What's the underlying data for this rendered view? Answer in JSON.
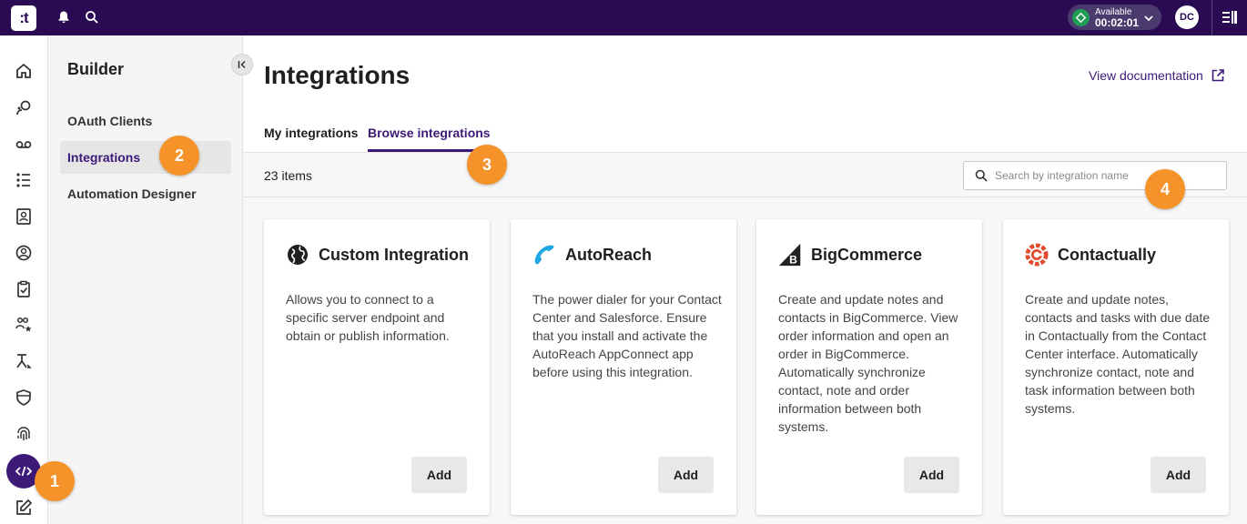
{
  "topbar": {
    "logo_text": ":t",
    "status_label": "Available",
    "status_timer": "00:02:01",
    "avatar_initials": "DC"
  },
  "sidebar": {
    "title": "Builder",
    "items": [
      {
        "label": "OAuth Clients"
      },
      {
        "label": "Integrations"
      },
      {
        "label": "Automation Designer"
      }
    ]
  },
  "main": {
    "title": "Integrations",
    "doc_link": "View documentation",
    "tabs": [
      {
        "label": "My integrations"
      },
      {
        "label": "Browse integrations"
      }
    ],
    "item_count": "23 items",
    "search_placeholder": "Search by integration name"
  },
  "cards": [
    {
      "title": "Custom Integration",
      "description": "Allows you to connect to a specific server endpoint and obtain or publish information.",
      "button": "Add",
      "icon": "globe-icon"
    },
    {
      "title": "AutoReach",
      "description": "The power dialer for your Contact Center and Salesforce. Ensure that you install and activate the AutoReach AppConnect app before using this integration.",
      "button": "Add",
      "icon": "autoreach-logo"
    },
    {
      "title": "BigCommerce",
      "description": "Create and update notes and contacts in BigCommerce. View order information and open an order in BigCommerce. Automatically synchronize contact, note and order information between both systems.",
      "button": "Add",
      "icon": "bigcommerce-logo"
    },
    {
      "title": "Contactually",
      "description": "Create and update notes, contacts and tasks with due date in Contactually from the Contact Center interface. Automatically synchronize contact, note and task information between both systems.",
      "button": "Add",
      "icon": "contactually-logo"
    }
  ],
  "badges": [
    "1",
    "2",
    "3",
    "4"
  ],
  "colors": {
    "brand": "#2a0a52",
    "accent": "#3d1a78",
    "badge": "#f5922a",
    "status": "#1f9d55"
  }
}
